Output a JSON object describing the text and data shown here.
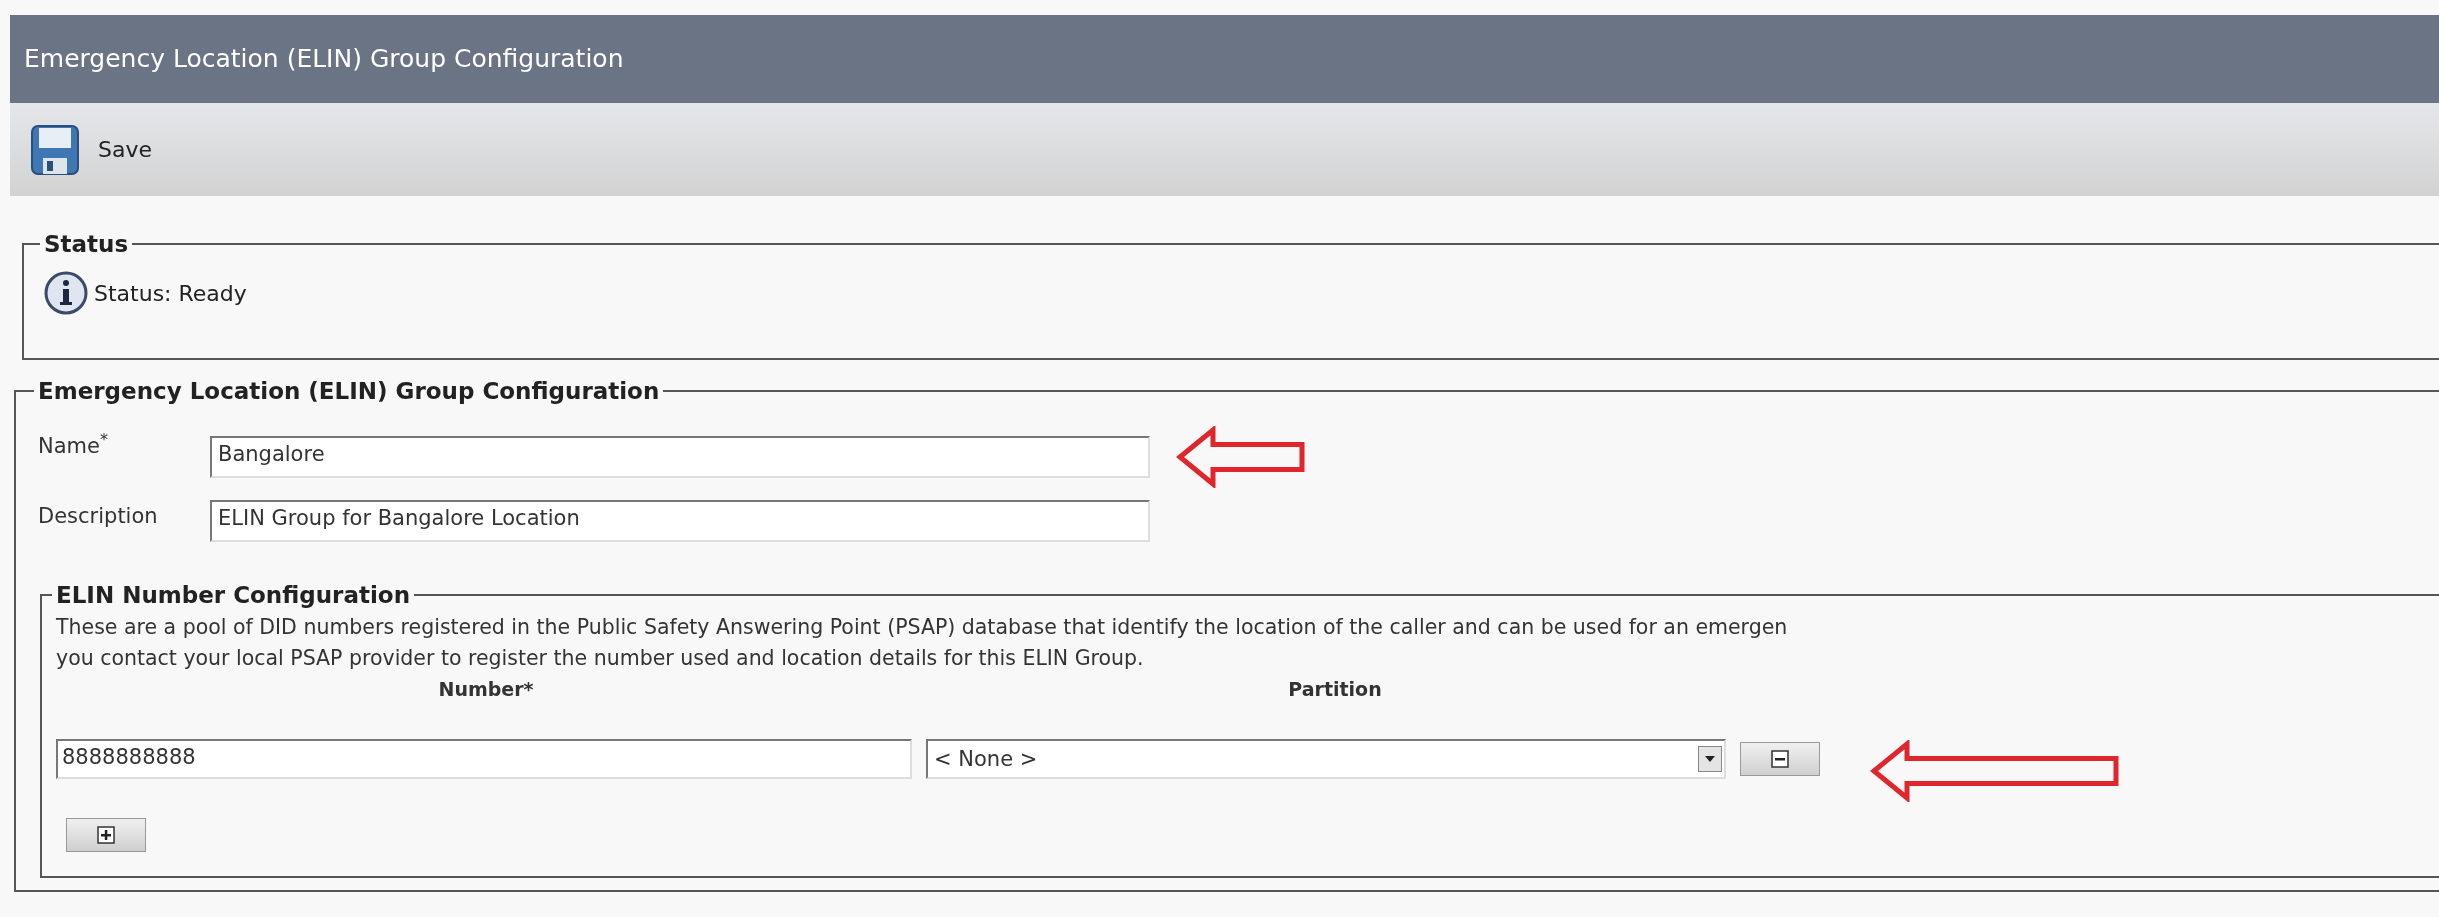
{
  "header": {
    "title": "Emergency Location (ELIN) Group Configuration"
  },
  "toolbar": {
    "buttons": [
      {
        "label": "Save"
      }
    ]
  },
  "status": {
    "legend": "Status",
    "message": "Status: Ready"
  },
  "group_config": {
    "legend": "Emergency Location (ELIN) Group Configuration",
    "fields": [
      {
        "label": "Name",
        "required_mark": "*",
        "value": "Bangalore",
        "callout": true
      },
      {
        "label": "Description",
        "value": "ELIN Group for Bangalore Location",
        "callout": false
      }
    ],
    "elin_numbers": {
      "legend": "ELIN Number Configuration",
      "description": "These are a pool of DID numbers registered in the Public Safety Answering Point (PSAP) database that identify the location of the caller and can be used for an emergen\nyou contact your local PSAP provider to register the number used and location details for this ELIN Group.",
      "columns": [
        {
          "label": "Number*"
        },
        {
          "label": "Partition"
        }
      ],
      "rows": [
        {
          "number": "8888888888",
          "partition": "< None >",
          "callout": true
        }
      ]
    }
  }
}
